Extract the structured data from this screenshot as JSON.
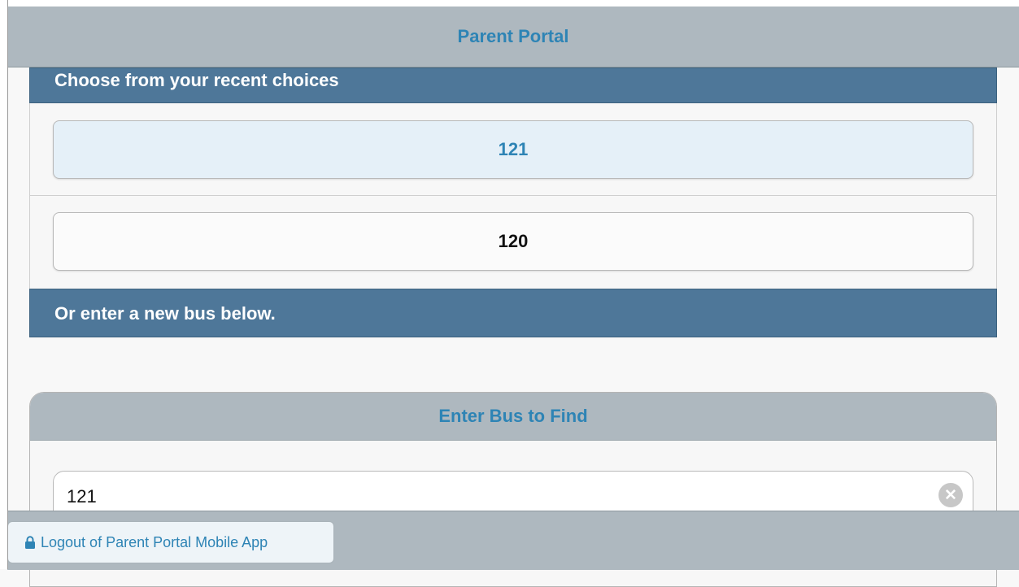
{
  "header": {
    "title": "Parent Portal"
  },
  "recent": {
    "heading": "Choose from your recent choices",
    "choices": [
      {
        "label": "121",
        "selected": true
      },
      {
        "label": "120",
        "selected": false
      }
    ]
  },
  "new_bus": {
    "heading": "Or enter a new bus below."
  },
  "find": {
    "title": "Enter Bus to Find",
    "input_value": "121",
    "clear_icon": "clear-circle-icon"
  },
  "footer": {
    "logout_label": "Logout of Parent Portal Mobile App",
    "logout_icon": "lock-icon"
  },
  "colors": {
    "header_bg": "#aeb8bf",
    "section_bar": "#4e7799",
    "accent_text": "#2e84b5",
    "selected_choice_bg": "#e5f0f8"
  }
}
